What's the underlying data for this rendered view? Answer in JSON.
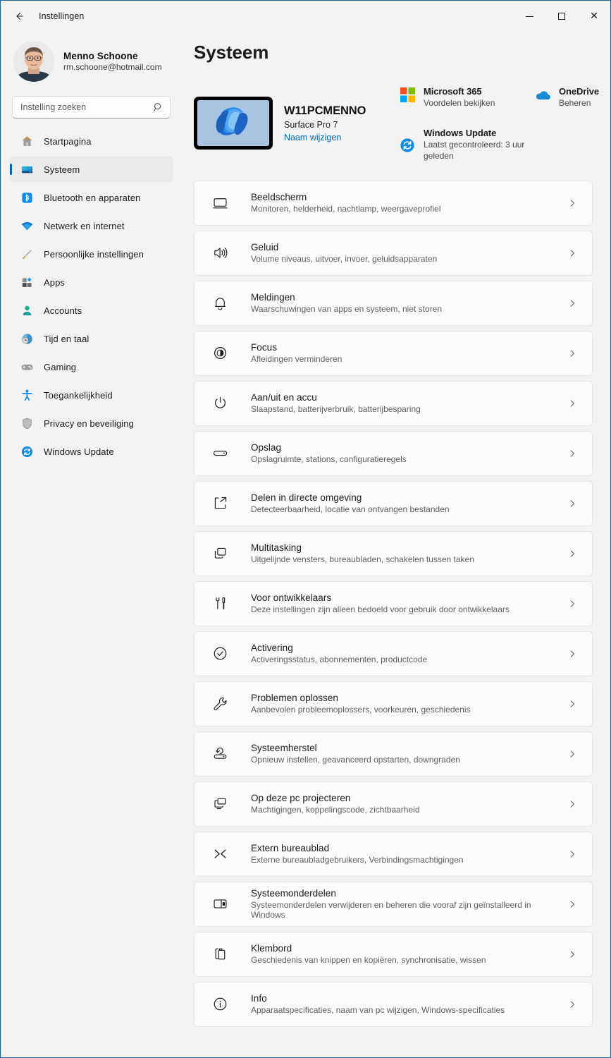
{
  "window": {
    "title": "Instellingen",
    "back_icon": "back-arrow-icon",
    "minimize_label": "Minimaliseren",
    "maximize_label": "Maximaliseren",
    "close_label": "Sluiten",
    "accent_color": "#0067c0"
  },
  "sidebar": {
    "account": {
      "name": "Menno Schoone",
      "email": "rm.schoone@hotmail.com"
    },
    "search": {
      "placeholder": "Instelling zoeken",
      "value": "",
      "icon": "search-icon"
    },
    "items": [
      {
        "label": "Startpagina",
        "icon": "home-icon",
        "active": false
      },
      {
        "label": "Systeem",
        "icon": "monitor-icon",
        "active": true
      },
      {
        "label": "Bluetooth en apparaten",
        "icon": "bluetooth-icon",
        "active": false
      },
      {
        "label": "Netwerk en internet",
        "icon": "wifi-icon",
        "active": false
      },
      {
        "label": "Persoonlijke instellingen",
        "icon": "brush-icon",
        "active": false
      },
      {
        "label": "Apps",
        "icon": "apps-icon",
        "active": false
      },
      {
        "label": "Accounts",
        "icon": "person-icon",
        "active": false
      },
      {
        "label": "Tijd en taal",
        "icon": "clock-globe-icon",
        "active": false
      },
      {
        "label": "Gaming",
        "icon": "gamepad-icon",
        "active": false
      },
      {
        "label": "Toegankelijkheid",
        "icon": "accessibility-icon",
        "active": false
      },
      {
        "label": "Privacy en beveiliging",
        "icon": "shield-icon",
        "active": false
      },
      {
        "label": "Windows Update",
        "icon": "update-sync-icon",
        "active": false
      }
    ]
  },
  "main": {
    "page_title": "Systeem",
    "device": {
      "name": "W11PCMENNO",
      "model": "Surface Pro 7",
      "rename_link": "Naam wijzigen",
      "thumb_icon": "windows-bloom-wallpaper"
    },
    "quick_cards": [
      {
        "title": "Microsoft 365",
        "subtitle": "Voordelen bekijken",
        "icon": "microsoft-logo-icon"
      },
      {
        "title": "OneDrive",
        "subtitle": "Beheren",
        "icon": "onedrive-cloud-icon"
      },
      {
        "title": "Windows Update",
        "subtitle": "Laatst gecontroleerd: 3 uur geleden",
        "icon": "update-sync-icon"
      }
    ],
    "settings": [
      {
        "title": "Beeldscherm",
        "subtitle": "Monitoren, helderheid, nachtlamp, weergaveprofiel",
        "icon": "display-icon"
      },
      {
        "title": "Geluid",
        "subtitle": "Volume niveaus, uitvoer, invoer, geluidsapparaten",
        "icon": "speaker-icon"
      },
      {
        "title": "Meldingen",
        "subtitle": "Waarschuwingen van apps en systeem, niet storen",
        "icon": "bell-icon"
      },
      {
        "title": "Focus",
        "subtitle": "Afleidingen verminderen",
        "icon": "focus-icon"
      },
      {
        "title": "Aan/uit en accu",
        "subtitle": "Slaapstand, batterijverbruik, batterijbesparing",
        "icon": "power-icon"
      },
      {
        "title": "Opslag",
        "subtitle": "Opslagruimte, stations, configuratieregels",
        "icon": "drive-icon"
      },
      {
        "title": "Delen in directe omgeving",
        "subtitle": "Detecteerbaarheid, locatie van ontvangen bestanden",
        "icon": "share-icon"
      },
      {
        "title": "Multitasking",
        "subtitle": "Uitgelijnde vensters, bureaubladen, schakelen tussen taken",
        "icon": "windows-stack-icon"
      },
      {
        "title": "Voor ontwikkelaars",
        "subtitle": "Deze instellingen zijn alleen bedoeld voor gebruik door ontwikkelaars",
        "icon": "tools-icon"
      },
      {
        "title": "Activering",
        "subtitle": "Activeringsstatus, abonnementen, productcode",
        "icon": "check-circle-icon"
      },
      {
        "title": "Problemen oplossen",
        "subtitle": "Aanbevolen probleemoplossers, voorkeuren, geschiedenis",
        "icon": "wrench-icon"
      },
      {
        "title": "Systeemherstel",
        "subtitle": "Opnieuw instellen, geavanceerd opstarten, downgraden",
        "icon": "recovery-icon"
      },
      {
        "title": "Op deze pc projecteren",
        "subtitle": "Machtigingen, koppelingscode, zichtbaarheid",
        "icon": "project-screen-icon"
      },
      {
        "title": "Extern bureaublad",
        "subtitle": "Externe bureaubladgebruikers, Verbindingsmachtigingen",
        "icon": "remote-desktop-icon"
      },
      {
        "title": "Systeemonderdelen",
        "subtitle": "Systeemonderdelen verwijderen en beheren die vooraf zijn geïnstalleerd in Windows",
        "icon": "components-icon"
      },
      {
        "title": "Klembord",
        "subtitle": "Geschiedenis van knippen en kopiëren, synchronisatie, wissen",
        "icon": "clipboard-icon"
      },
      {
        "title": "Info",
        "subtitle": "Apparaatspecificaties, naam van pc wijzigen, Windows-specificaties",
        "icon": "info-icon"
      }
    ]
  }
}
